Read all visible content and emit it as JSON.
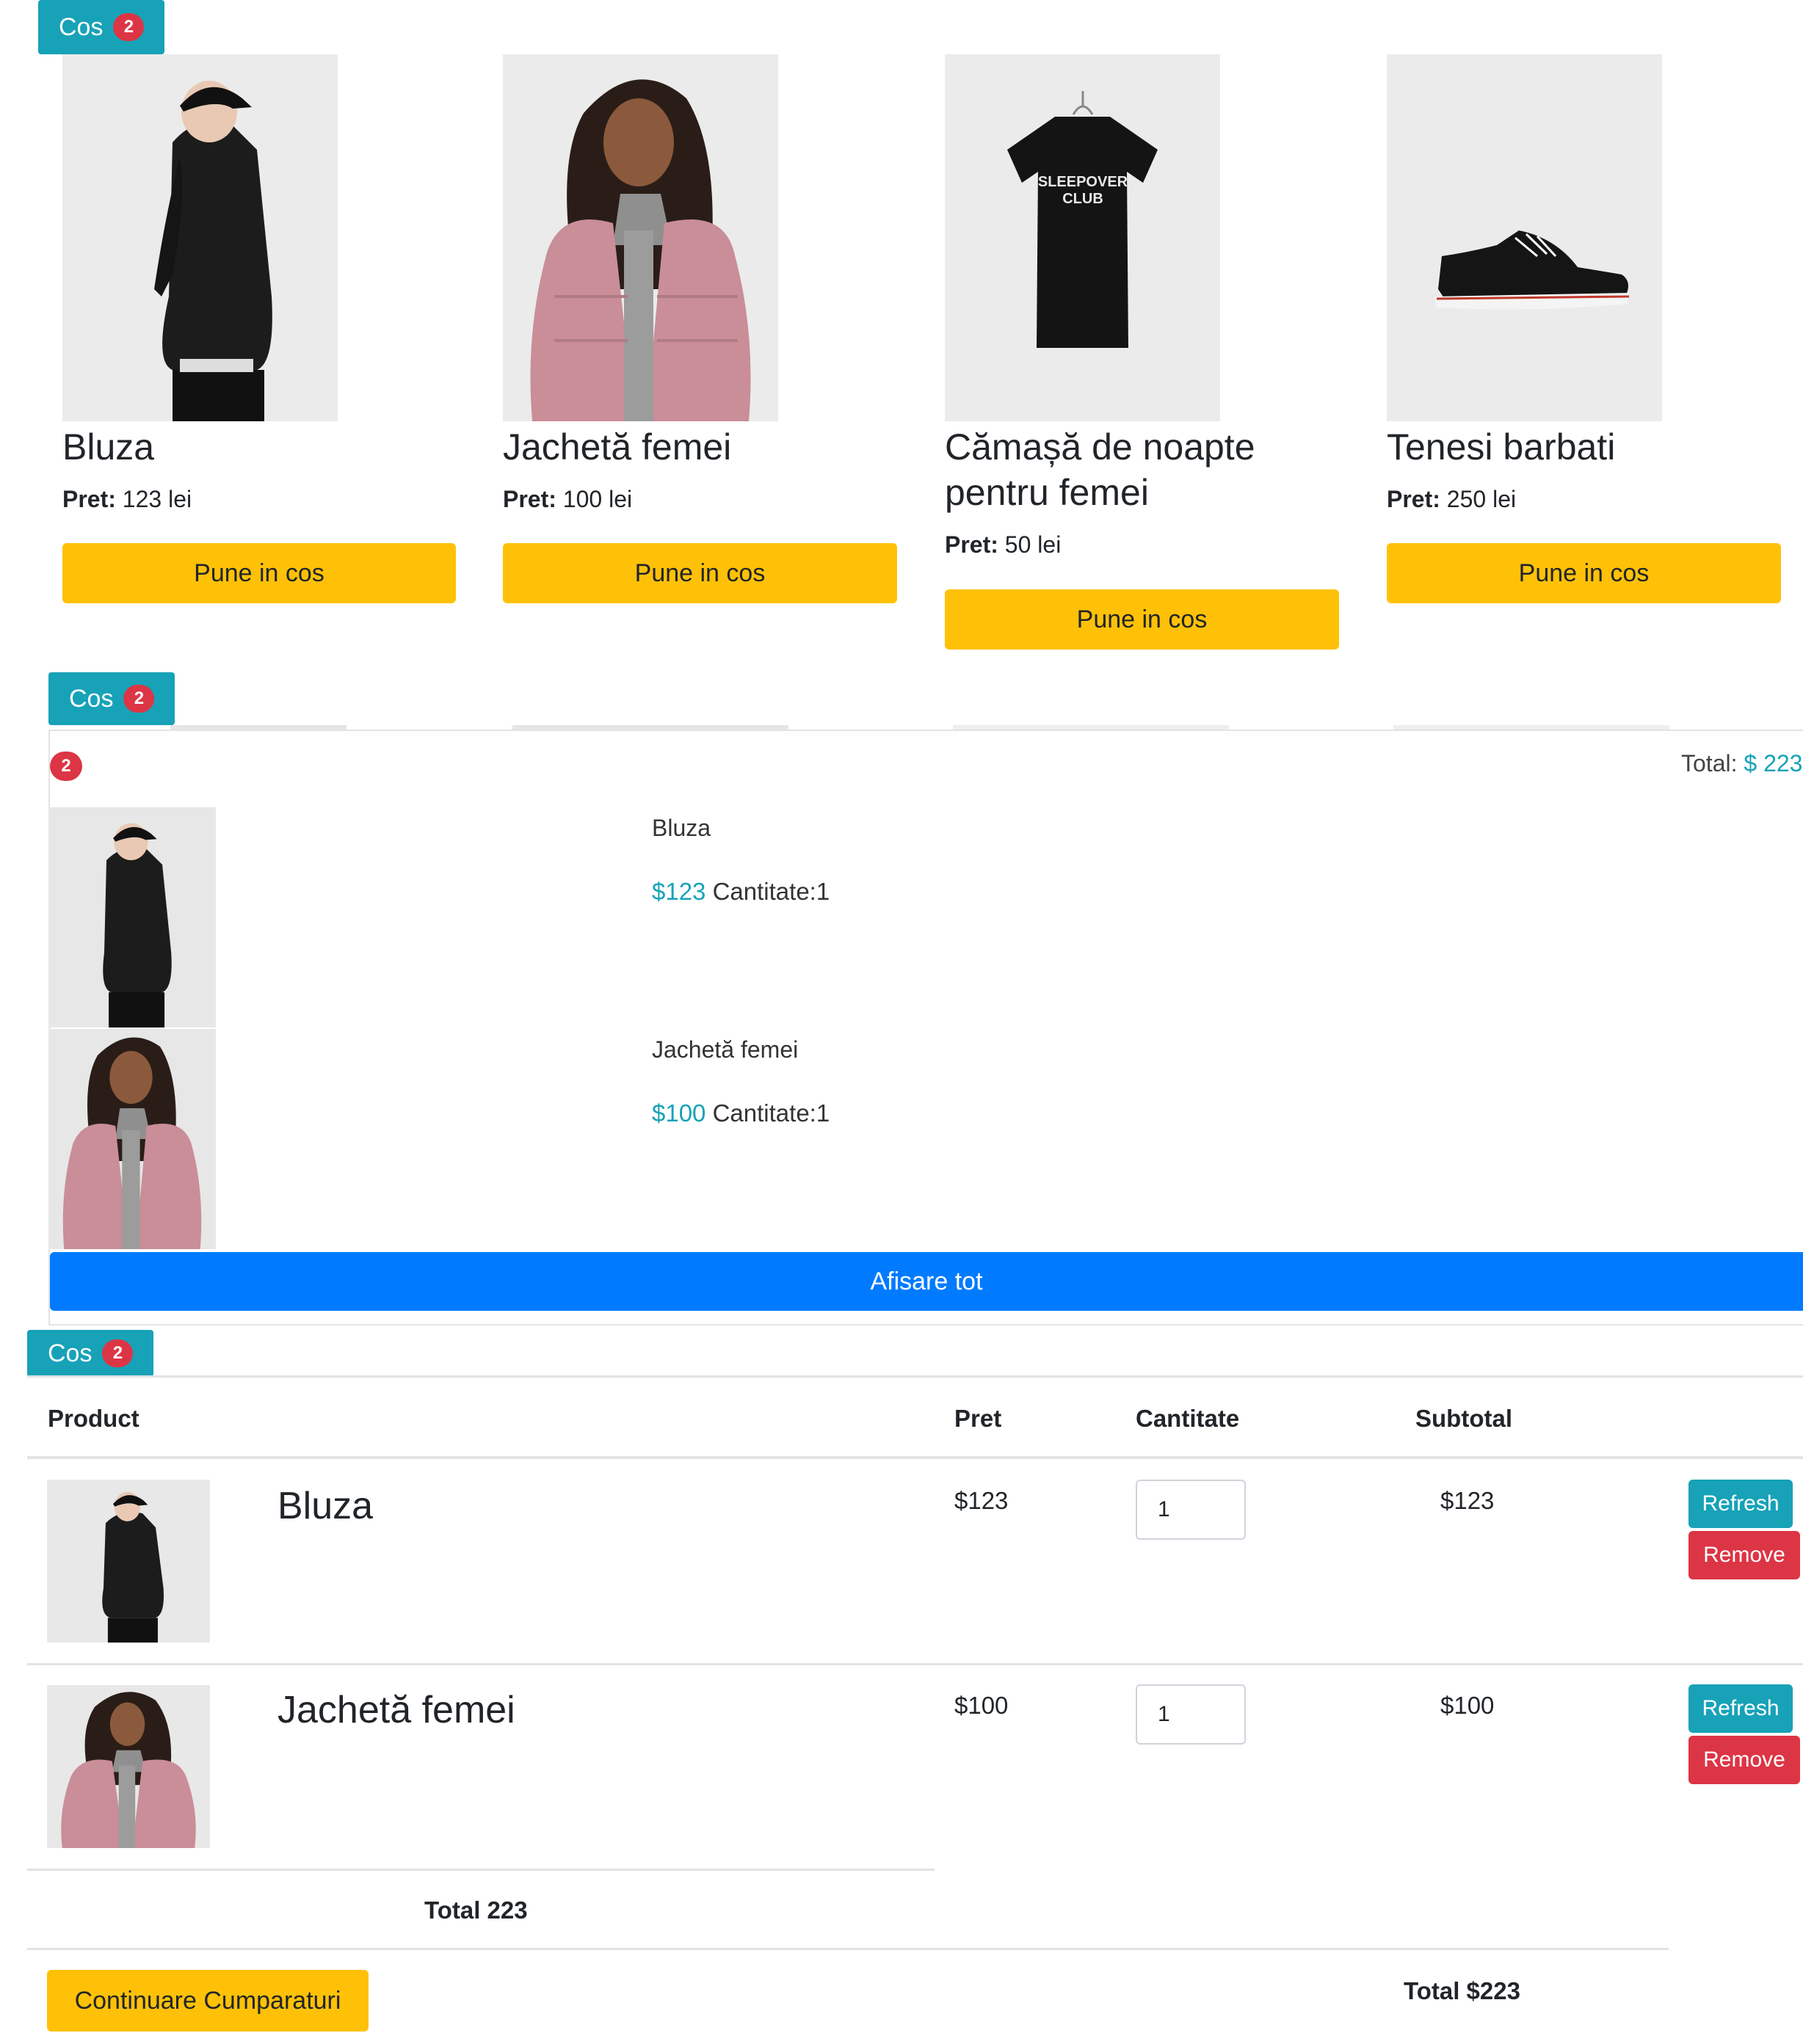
{
  "cart_button": {
    "label": "Cos",
    "count": "2"
  },
  "currency_unit": "lei",
  "price_label": "Pret:",
  "products": [
    {
      "name": "Bluza",
      "price": "123 lei",
      "button": "Pune in cos"
    },
    {
      "name": "Jachetă femei",
      "price": "100 lei",
      "button": "Pune in cos"
    },
    {
      "name": "Cămașă de noapte pentru femei",
      "price": "50 lei",
      "button": "Pune in cos"
    },
    {
      "name": "Tenesi barbati",
      "price": "250 lei",
      "button": "Pune in cos"
    }
  ],
  "tshirt_print": {
    "line1": "SLEEPOVER",
    "line2": "CLUB"
  },
  "dropdown": {
    "count": "2",
    "total_label": "Total:",
    "total_value": "$ 223",
    "items": [
      {
        "name": "Bluza",
        "price": "$123",
        "qty": "Cantitate:1"
      },
      {
        "name": "Jachetă femei",
        "price": "$100",
        "qty": "Cantitate:1"
      }
    ],
    "show_all": "Afisare tot"
  },
  "table": {
    "headers": {
      "product": "Product",
      "price": "Pret",
      "qty": "Cantitate",
      "subtotal": "Subtotal"
    },
    "rows": [
      {
        "name": "Bluza",
        "price": "$123",
        "qty": "1",
        "subtotal": "$123",
        "refresh": "Refresh",
        "remove": "Remove"
      },
      {
        "name": "Jachetă femei",
        "price": "$100",
        "qty": "1",
        "subtotal": "$100",
        "refresh": "Refresh",
        "remove": "Remove"
      }
    ],
    "total_row": "Total 223",
    "continue": "Continuare Cumparaturi",
    "grand_total": "Total $223"
  },
  "colors": {
    "teal": "#17a2b8",
    "red": "#dc3545",
    "yellow": "#ffc107",
    "blue": "#007bff"
  }
}
